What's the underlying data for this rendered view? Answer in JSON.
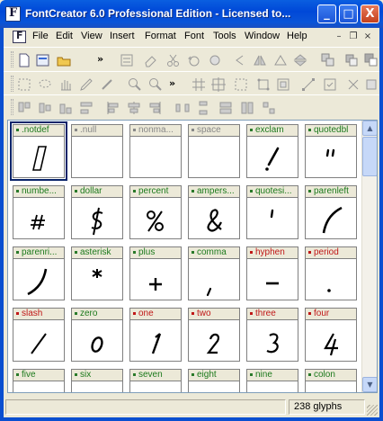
{
  "window": {
    "title": "FontCreator 6.0 Professional Edition - Licensed to...",
    "min_label": "_",
    "max_label": "□",
    "close_label": "X"
  },
  "menu": {
    "items": [
      "File",
      "Edit",
      "View",
      "Insert",
      "Format",
      "Font",
      "Tools",
      "Window",
      "Help"
    ],
    "mdi_min": "–",
    "mdi_restore": "❐",
    "mdi_close": "×"
  },
  "toolbar": {
    "chevron": "»"
  },
  "glyphs": [
    {
      "name": ".notdef",
      "color": "green",
      "icon": "notdef-glyph"
    },
    {
      "name": ".null",
      "color": "empty",
      "icon": ""
    },
    {
      "name": "nonma...",
      "color": "empty",
      "icon": ""
    },
    {
      "name": "space",
      "color": "empty",
      "icon": ""
    },
    {
      "name": "exclam",
      "color": "green",
      "icon": "exclam-glyph"
    },
    {
      "name": "quotedbl",
      "color": "green",
      "icon": "quotedbl-glyph"
    },
    {
      "name": "numbe...",
      "color": "green",
      "icon": "numbersign-glyph"
    },
    {
      "name": "dollar",
      "color": "green",
      "icon": "dollar-glyph"
    },
    {
      "name": "percent",
      "color": "green",
      "icon": "percent-glyph"
    },
    {
      "name": "ampers...",
      "color": "green",
      "icon": "ampersand-glyph"
    },
    {
      "name": "quotesi...",
      "color": "green",
      "icon": "quotesingle-glyph"
    },
    {
      "name": "parenleft",
      "color": "green",
      "icon": "parenleft-glyph"
    },
    {
      "name": "parenri...",
      "color": "green",
      "icon": "parenright-glyph"
    },
    {
      "name": "asterisk",
      "color": "green",
      "icon": "asterisk-glyph"
    },
    {
      "name": "plus",
      "color": "green",
      "icon": "plus-glyph"
    },
    {
      "name": "comma",
      "color": "green",
      "icon": "comma-glyph"
    },
    {
      "name": "hyphen",
      "color": "red",
      "icon": "hyphen-glyph"
    },
    {
      "name": "period",
      "color": "red",
      "icon": "period-glyph"
    },
    {
      "name": "slash",
      "color": "red",
      "icon": "slash-glyph"
    },
    {
      "name": "zero",
      "color": "green",
      "icon": "zero-glyph"
    },
    {
      "name": "one",
      "color": "red",
      "icon": "one-glyph"
    },
    {
      "name": "two",
      "color": "red",
      "icon": "two-glyph"
    },
    {
      "name": "three",
      "color": "red",
      "icon": "three-glyph"
    },
    {
      "name": "four",
      "color": "red",
      "icon": "four-glyph"
    },
    {
      "name": "five",
      "color": "green",
      "icon": ""
    },
    {
      "name": "six",
      "color": "green",
      "icon": ""
    },
    {
      "name": "seven",
      "color": "green",
      "icon": ""
    },
    {
      "name": "eight",
      "color": "green",
      "icon": ""
    },
    {
      "name": "nine",
      "color": "green",
      "icon": ""
    },
    {
      "name": "colon",
      "color": "green",
      "icon": ""
    }
  ],
  "scrollbar": {
    "up": "▲",
    "down": "▼"
  },
  "status": {
    "glyph_count": "238 glyphs"
  },
  "colors": {
    "title_bar": "#0a54d8",
    "glyph_name_green": "#1c7a1c",
    "glyph_name_red": "#c01818",
    "selection": "#0a246a"
  }
}
